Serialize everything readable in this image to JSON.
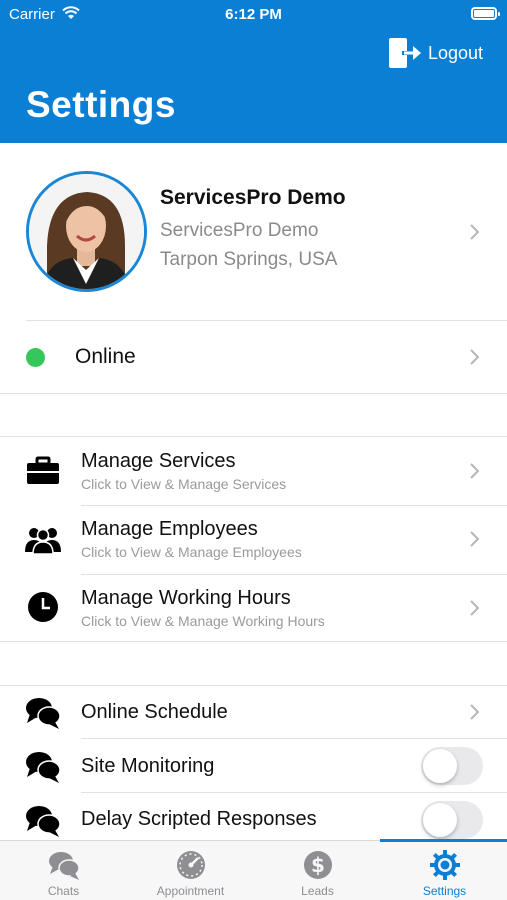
{
  "status_bar": {
    "carrier": "Carrier",
    "time": "6:12 PM"
  },
  "header": {
    "title": "Settings",
    "logout_label": "Logout",
    "background_color": "#0a7fd4"
  },
  "profile": {
    "name": "ServicesPro Demo",
    "company": "ServicesPro Demo",
    "location": "Tarpon Springs, USA"
  },
  "status": {
    "label": "Online",
    "dot_color": "#35c759"
  },
  "manage_items": [
    {
      "title": "Manage Services",
      "subtitle": "Click to View & Manage Services",
      "icon": "briefcase-icon"
    },
    {
      "title": "Manage Employees",
      "subtitle": "Click to View & Manage Employees",
      "icon": "people-icon"
    },
    {
      "title": "Manage Working Hours",
      "subtitle": "Click to View & Manage Working Hours",
      "icon": "clock-icon"
    }
  ],
  "chat_items": [
    {
      "title": "Online Schedule",
      "control": "chevron",
      "icon": "chat-bubbles-icon"
    },
    {
      "title": "Site Monitoring",
      "control": "toggle",
      "enabled": false,
      "icon": "chat-bubbles-icon"
    },
    {
      "title": "Delay Scripted Responses",
      "control": "toggle",
      "enabled": false,
      "icon": "chat-bubbles-icon"
    }
  ],
  "tabs": [
    {
      "label": "Chats",
      "icon": "chats-icon",
      "active": false
    },
    {
      "label": "Appointment",
      "icon": "speedometer-icon",
      "active": false
    },
    {
      "label": "Leads",
      "icon": "dollar-icon",
      "active": false
    },
    {
      "label": "Settings",
      "icon": "gear-icon",
      "active": true
    }
  ]
}
